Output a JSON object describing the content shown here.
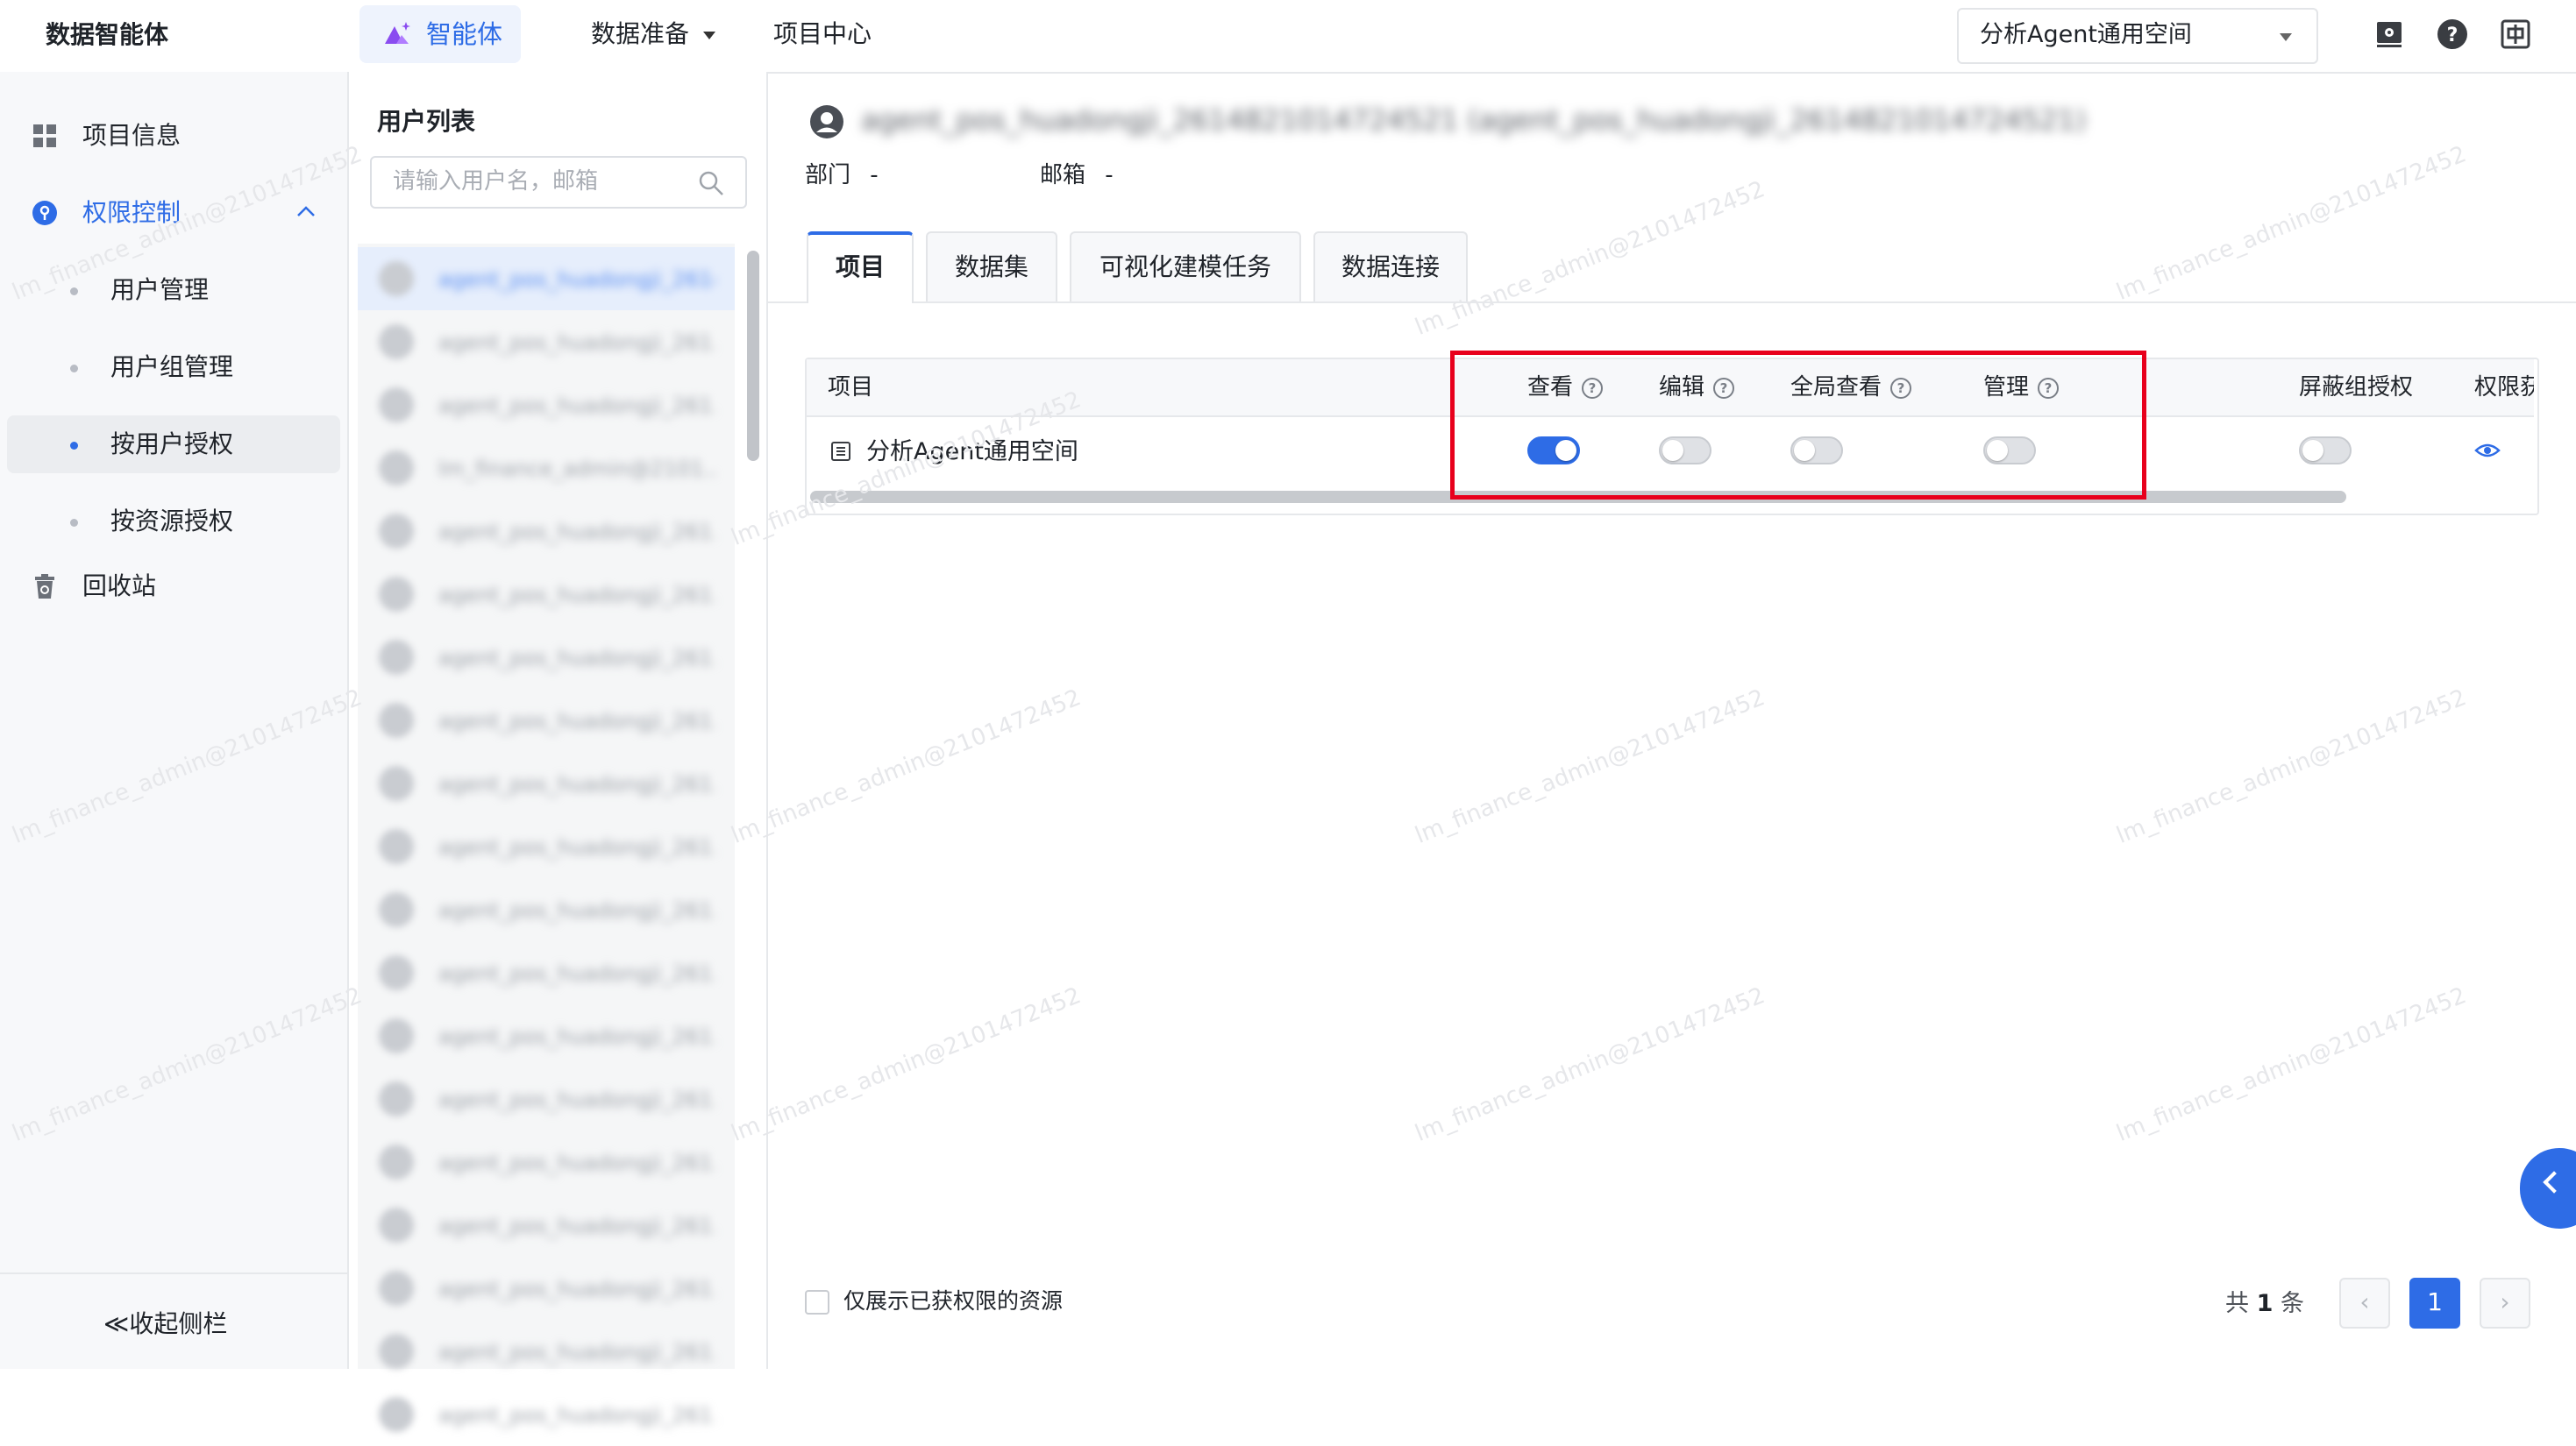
{
  "app": {
    "title": "数据智能体"
  },
  "topnav": {
    "active_label": "智能体",
    "items": [
      {
        "label": "数据准备"
      },
      {
        "label": "项目中心"
      }
    ],
    "space_select": "分析Agent通用空间"
  },
  "sidebar": {
    "items": [
      {
        "label": "项目信息"
      },
      {
        "label": "权限控制"
      }
    ],
    "sub_items": [
      {
        "label": "用户管理"
      },
      {
        "label": "用户组管理"
      },
      {
        "label": "按用户授权"
      },
      {
        "label": "按资源授权"
      }
    ],
    "recycle": "回收站",
    "collapse": "≪收起侧栏"
  },
  "user_panel": {
    "title": "用户列表",
    "search_placeholder": "请输入用户名，邮箱",
    "users": [
      "agent_pos_huadongji_2614...",
      "agent_pos_huadongji_261...",
      "agent_pos_huadongji_261...",
      "lm_finance_admin@2101...",
      "agent_pos_huadongji_261...",
      "agent_pos_huadongji_261...",
      "agent_pos_huadongji_261...",
      "agent_pos_huadongji_261...",
      "agent_pos_huadongji_261...",
      "agent_pos_huadongji_261...",
      "agent_pos_huadongji_261...",
      "agent_pos_huadongji_261...",
      "agent_pos_huadongji_261...",
      "agent_pos_huadongji_261...",
      "agent_pos_huadongji_261...",
      "agent_pos_huadongji_261...",
      "agent_pos_huadongji_261...",
      "agent_pos_huadongji_261...",
      "agent_pos_huadongji_261..."
    ]
  },
  "detail": {
    "user_title": "agent_pos_huadongji_2614821014724521 (agent_pos_huadongji_2614821014724521)",
    "dept_label": "部门",
    "dept_value": "-",
    "email_label": "邮箱",
    "email_value": "-",
    "tabs": [
      {
        "label": "项目"
      },
      {
        "label": "数据集"
      },
      {
        "label": "可视化建模任务"
      },
      {
        "label": "数据连接"
      }
    ]
  },
  "table": {
    "columns": {
      "project": "项目",
      "view": "查看",
      "edit": "编辑",
      "global_view": "全局查看",
      "manage": "管理",
      "block_group": "屏蔽组授权",
      "perm": "权限获"
    },
    "rows": [
      {
        "name": "分析Agent通用空间",
        "view": true,
        "edit": false,
        "global_view": false,
        "manage": false,
        "block_group": false
      }
    ]
  },
  "footer": {
    "checkbox_label": "仅展示已获权限的资源",
    "total_prefix": "共",
    "total_count": "1",
    "total_suffix": "条",
    "current_page": "1",
    "prev": "‹",
    "next": "›"
  },
  "watermark_text": "lm_finance_admin@2101472452",
  "colors": {
    "accent": "#2e6ce6",
    "highlight": "#e8001c"
  }
}
